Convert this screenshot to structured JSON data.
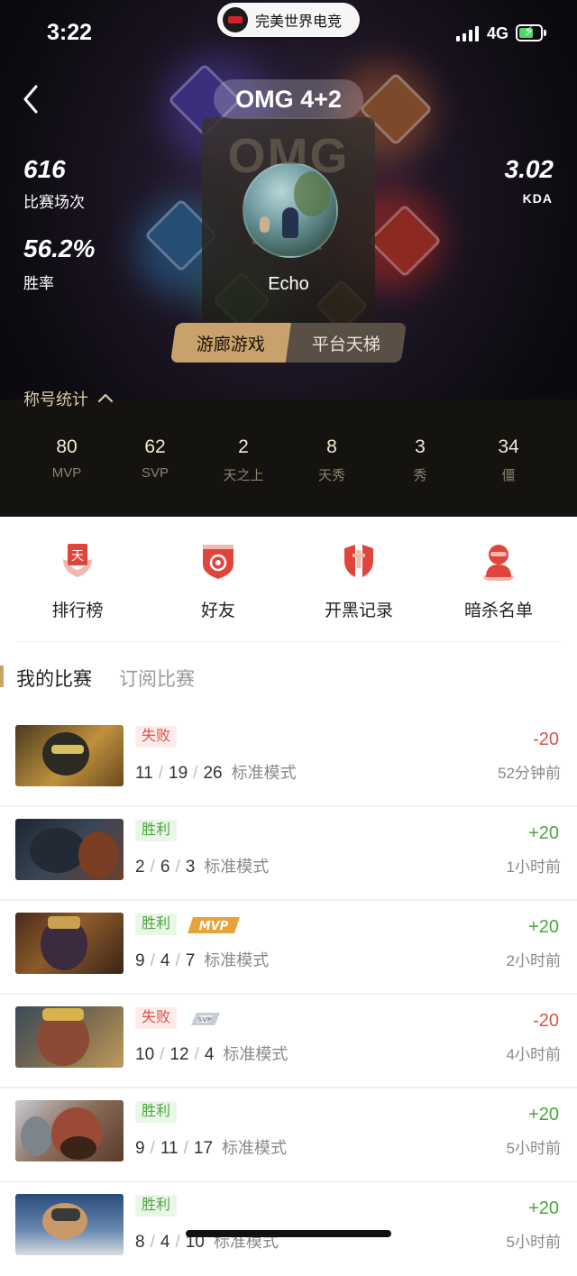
{
  "status_bar": {
    "time": "3:22",
    "app_pill": "完美世界电竞",
    "network": "4G"
  },
  "header": {
    "title": "OMG 4+2"
  },
  "profile": {
    "matches_value": "616",
    "matches_label": "比赛场次",
    "winrate_value": "56.2%",
    "winrate_label": "胜率",
    "kda_value": "3.02",
    "kda_label": "KDA",
    "username": "Echo"
  },
  "segment": {
    "active": "游廊游戏",
    "inactive": "平台天梯"
  },
  "titles": {
    "heading": "称号统计",
    "items": [
      {
        "num": "80",
        "label": "MVP"
      },
      {
        "num": "62",
        "label": "SVP"
      },
      {
        "num": "2",
        "label": "天之上"
      },
      {
        "num": "8",
        "label": "天秀"
      },
      {
        "num": "3",
        "label": "秀"
      },
      {
        "num": "34",
        "label": "僵"
      }
    ]
  },
  "actions": [
    {
      "label": "排行榜",
      "icon": "leaderboard-icon"
    },
    {
      "label": "好友",
      "icon": "friends-icon"
    },
    {
      "label": "开黑记录",
      "icon": "party-record-icon"
    },
    {
      "label": "暗杀名单",
      "icon": "assassination-list-icon"
    }
  ],
  "tabs": {
    "active": "我的比赛",
    "inactive": "订阅比赛"
  },
  "matches": [
    {
      "result": "失败",
      "win": false,
      "k": "11",
      "d": "19",
      "a": "26",
      "mode": "标准模式",
      "score": "-20",
      "ago": "52分钟前",
      "tag": ""
    },
    {
      "result": "胜利",
      "win": true,
      "k": "2",
      "d": "6",
      "a": "3",
      "mode": "标准模式",
      "score": "+20",
      "ago": "1小时前",
      "tag": ""
    },
    {
      "result": "胜利",
      "win": true,
      "k": "9",
      "d": "4",
      "a": "7",
      "mode": "标准模式",
      "score": "+20",
      "ago": "2小时前",
      "tag": "MVP"
    },
    {
      "result": "失败",
      "win": false,
      "k": "10",
      "d": "12",
      "a": "4",
      "mode": "标准模式",
      "score": "-20",
      "ago": "4小时前",
      "tag": "SVP"
    },
    {
      "result": "胜利",
      "win": true,
      "k": "9",
      "d": "11",
      "a": "17",
      "mode": "标准模式",
      "score": "+20",
      "ago": "5小时前",
      "tag": ""
    },
    {
      "result": "胜利",
      "win": true,
      "k": "8",
      "d": "4",
      "a": "10",
      "mode": "标准模式",
      "score": "+20",
      "ago": "5小时前",
      "tag": ""
    }
  ],
  "colors": {
    "accent_gold": "#c9a16c",
    "win_green": "#4aa63c",
    "lose_red": "#d9524a",
    "icon_red": "#e0453c"
  }
}
